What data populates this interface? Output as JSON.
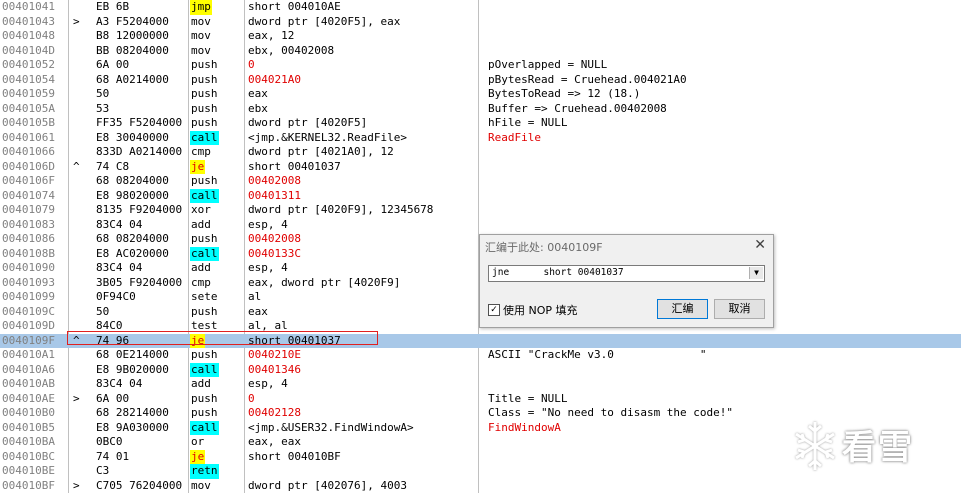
{
  "disasm": [
    {
      "addr": "00401041",
      "mark": "",
      "hex": "EB 6B",
      "mnem": "jmp",
      "mstyle": "m-jmp",
      "ops": "short 004010AE",
      "opsstyle": "op-normal",
      "comment": "",
      "cstyle": ""
    },
    {
      "addr": "00401043",
      "mark": ">",
      "hex": "A3 F5204000",
      "mnem": "mov",
      "mstyle": "m-plain",
      "ops": "dword ptr [4020F5], eax",
      "opsstyle": "op-normal",
      "comment": "",
      "cstyle": ""
    },
    {
      "addr": "00401048",
      "mark": "",
      "hex": "B8 12000000",
      "mnem": "mov",
      "mstyle": "m-plain",
      "ops": "eax, 12",
      "opsstyle": "op-normal",
      "comment": "",
      "cstyle": ""
    },
    {
      "addr": "0040104D",
      "mark": "",
      "hex": "BB 08204000",
      "mnem": "mov",
      "mstyle": "m-plain",
      "ops": "ebx, 00402008",
      "opsstyle": "op-normal",
      "comment": "",
      "cstyle": ""
    },
    {
      "addr": "00401052",
      "mark": "",
      "hex": "6A 00",
      "mnem": "push",
      "mstyle": "m-plain",
      "ops": "0",
      "opsstyle": "op-imm",
      "comment": "pOverlapped = NULL",
      "cstyle": "com-plain"
    },
    {
      "addr": "00401054",
      "mark": "",
      "hex": "68 A0214000",
      "mnem": "push",
      "mstyle": "m-plain",
      "ops": "004021A0",
      "opsstyle": "op-imm",
      "comment": "pBytesRead = Cruehead.004021A0",
      "cstyle": "com-plain"
    },
    {
      "addr": "00401059",
      "mark": "",
      "hex": "50",
      "mnem": "push",
      "mstyle": "m-plain",
      "ops": "eax",
      "opsstyle": "op-normal",
      "comment": "BytesToRead => 12 (18.)",
      "cstyle": "com-plain"
    },
    {
      "addr": "0040105A",
      "mark": "",
      "hex": "53",
      "mnem": "push",
      "mstyle": "m-plain",
      "ops": "ebx",
      "opsstyle": "op-normal",
      "comment": "Buffer => Cruehead.00402008",
      "cstyle": "com-plain"
    },
    {
      "addr": "0040105B",
      "mark": "",
      "hex": "FF35 F5204000",
      "mnem": "push",
      "mstyle": "m-plain",
      "ops": "dword ptr [4020F5]",
      "opsstyle": "op-normal",
      "comment": "hFile = NULL",
      "cstyle": "com-plain"
    },
    {
      "addr": "00401061",
      "mark": "",
      "hex": "E8 30040000",
      "mnem": "call",
      "mstyle": "m-call",
      "ops": "<jmp.&KERNEL32.ReadFile>",
      "opsstyle": "op-normal",
      "comment": "ReadFile",
      "cstyle": "com-api"
    },
    {
      "addr": "00401066",
      "mark": "",
      "hex": "833D A0214000",
      "mnem": "cmp",
      "mstyle": "m-plain",
      "ops": "dword ptr [4021A0], 12",
      "opsstyle": "op-normal",
      "comment": "",
      "cstyle": ""
    },
    {
      "addr": "0040106D",
      "mark": "^",
      "hex": "74 C8",
      "mnem": "je",
      "mstyle": "m-jcc",
      "ops": "short 00401037",
      "opsstyle": "op-normal",
      "comment": "",
      "cstyle": ""
    },
    {
      "addr": "0040106F",
      "mark": "",
      "hex": "68 08204000",
      "mnem": "push",
      "mstyle": "m-plain",
      "ops": "00402008",
      "opsstyle": "op-imm",
      "comment": "",
      "cstyle": ""
    },
    {
      "addr": "00401074",
      "mark": "",
      "hex": "E8 98020000",
      "mnem": "call",
      "mstyle": "m-call",
      "ops": "00401311",
      "opsstyle": "op-imm",
      "comment": "",
      "cstyle": ""
    },
    {
      "addr": "00401079",
      "mark": "",
      "hex": "8135 F9204000",
      "mnem": "xor",
      "mstyle": "m-plain",
      "ops": "dword ptr [4020F9], 12345678",
      "opsstyle": "op-normal",
      "comment": "",
      "cstyle": ""
    },
    {
      "addr": "00401083",
      "mark": "",
      "hex": "83C4 04",
      "mnem": "add",
      "mstyle": "m-plain",
      "ops": "esp, 4",
      "opsstyle": "op-normal",
      "comment": "",
      "cstyle": ""
    },
    {
      "addr": "00401086",
      "mark": "",
      "hex": "68 08204000",
      "mnem": "push",
      "mstyle": "m-plain",
      "ops": "00402008",
      "opsstyle": "op-imm",
      "comment": "",
      "cstyle": ""
    },
    {
      "addr": "0040108B",
      "mark": "",
      "hex": "E8 AC020000",
      "mnem": "call",
      "mstyle": "m-call",
      "ops": "0040133C",
      "opsstyle": "op-imm",
      "comment": "",
      "cstyle": ""
    },
    {
      "addr": "00401090",
      "mark": "",
      "hex": "83C4 04",
      "mnem": "add",
      "mstyle": "m-plain",
      "ops": "esp, 4",
      "opsstyle": "op-normal",
      "comment": "",
      "cstyle": ""
    },
    {
      "addr": "00401093",
      "mark": "",
      "hex": "3B05 F9204000",
      "mnem": "cmp",
      "mstyle": "m-plain",
      "ops": "eax, dword ptr [4020F9]",
      "opsstyle": "op-normal",
      "comment": "",
      "cstyle": ""
    },
    {
      "addr": "00401099",
      "mark": "",
      "hex": "0F94C0",
      "mnem": "sete",
      "mstyle": "m-plain",
      "ops": "al",
      "opsstyle": "op-normal",
      "comment": "",
      "cstyle": ""
    },
    {
      "addr": "0040109C",
      "mark": "",
      "hex": "50",
      "mnem": "push",
      "mstyle": "m-plain",
      "ops": "eax",
      "opsstyle": "op-normal",
      "comment": "",
      "cstyle": ""
    },
    {
      "addr": "0040109D",
      "mark": "",
      "hex": "84C0",
      "mnem": "test",
      "mstyle": "m-plain",
      "ops": "al, al",
      "opsstyle": "op-normal",
      "comment": "",
      "cstyle": ""
    },
    {
      "addr": "0040109F",
      "mark": "^",
      "hex": "74 96",
      "mnem": "je",
      "mstyle": "m-jcc",
      "ops": "short 00401037",
      "opsstyle": "op-normal",
      "comment": "",
      "cstyle": ""
    },
    {
      "addr": "004010A1",
      "mark": "",
      "hex": "68 0E214000",
      "mnem": "push",
      "mstyle": "m-plain",
      "ops": "0040210E",
      "opsstyle": "op-imm",
      "comment": "ASCII \"CrackMe v3.0             \"",
      "cstyle": "com-plain"
    },
    {
      "addr": "004010A6",
      "mark": "",
      "hex": "E8 9B020000",
      "mnem": "call",
      "mstyle": "m-call",
      "ops": "00401346",
      "opsstyle": "op-imm",
      "comment": "",
      "cstyle": ""
    },
    {
      "addr": "004010AB",
      "mark": "",
      "hex": "83C4 04",
      "mnem": "add",
      "mstyle": "m-plain",
      "ops": "esp, 4",
      "opsstyle": "op-normal",
      "comment": "",
      "cstyle": ""
    },
    {
      "addr": "004010AE",
      "mark": ">",
      "hex": "6A 00",
      "mnem": "push",
      "mstyle": "m-plain",
      "ops": "0",
      "opsstyle": "op-imm",
      "comment": "Title = NULL",
      "cstyle": "com-plain"
    },
    {
      "addr": "004010B0",
      "mark": "",
      "hex": "68 28214000",
      "mnem": "push",
      "mstyle": "m-plain",
      "ops": "00402128",
      "opsstyle": "op-imm",
      "comment": "Class = \"No need to disasm the code!\"",
      "cstyle": "com-plain"
    },
    {
      "addr": "004010B5",
      "mark": "",
      "hex": "E8 9A030000",
      "mnem": "call",
      "mstyle": "m-call",
      "ops": "<jmp.&USER32.FindWindowA>",
      "opsstyle": "op-normal",
      "comment": "FindWindowA",
      "cstyle": "com-api"
    },
    {
      "addr": "004010BA",
      "mark": "",
      "hex": "0BC0",
      "mnem": "or",
      "mstyle": "m-plain",
      "ops": "eax, eax",
      "opsstyle": "op-normal",
      "comment": "",
      "cstyle": ""
    },
    {
      "addr": "004010BC",
      "mark": "",
      "hex": "74 01",
      "mnem": "je",
      "mstyle": "m-jcc",
      "ops": "short 004010BF",
      "opsstyle": "op-normal",
      "comment": "",
      "cstyle": ""
    },
    {
      "addr": "004010BE",
      "mark": "",
      "hex": "C3",
      "mnem": "retn",
      "mstyle": "m-ret",
      "ops": "",
      "opsstyle": "op-normal",
      "comment": "",
      "cstyle": ""
    },
    {
      "addr": "004010BF",
      "mark": ">",
      "hex": "C705 76204000",
      "mnem": "mov",
      "mstyle": "m-plain",
      "ops": "dword ptr [402076], 4003",
      "opsstyle": "op-normal",
      "comment": "",
      "cstyle": ""
    }
  ],
  "selected_addr": "0040109F",
  "dialog": {
    "title": "汇编于此处: 0040109F",
    "close": "✕",
    "input_value": "jne      short 00401037",
    "combo_arrow": "▼",
    "checkbox_mark": "✓",
    "checkbox_label": "使用 NOP 填充",
    "assemble_label": "汇编",
    "cancel_label": "取消"
  },
  "watermark": {
    "text": "看雪",
    "icon": "snowflake-icon",
    "color": "#ffffff"
  },
  "colors": {
    "selection": "#a8c8e8",
    "selection_border": "#e02020",
    "call_bg": "#00ffff",
    "jump_bg": "#ffff00",
    "api_text": "#e00000"
  }
}
